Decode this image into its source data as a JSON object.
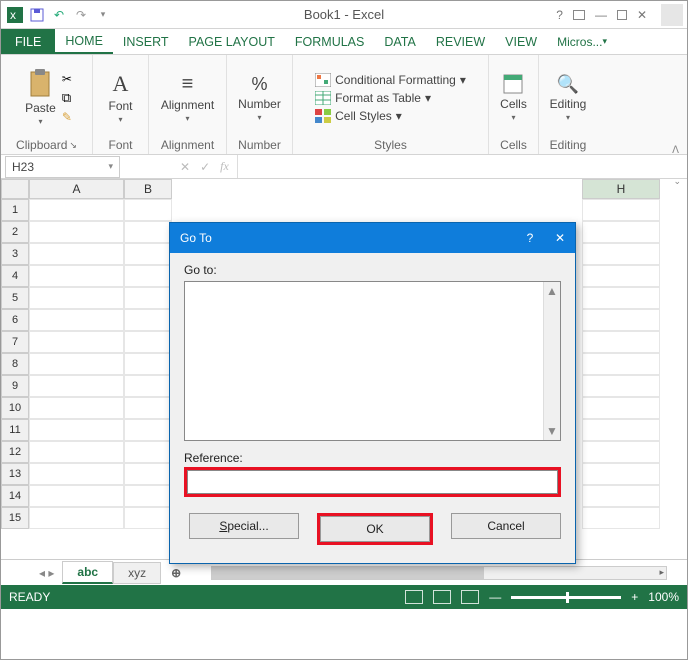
{
  "window": {
    "title": "Book1 - Excel"
  },
  "tabs": {
    "file": "FILE",
    "home": "HOME",
    "insert": "INSERT",
    "page_layout": "PAGE LAYOUT",
    "formulas": "FORMULAS",
    "data": "DATA",
    "review": "REVIEW",
    "view": "VIEW",
    "account": "Micros..."
  },
  "ribbon": {
    "clipboard": {
      "paste": "Paste",
      "label": "Clipboard"
    },
    "font": {
      "btn": "Font",
      "label": "Font"
    },
    "alignment": {
      "btn": "Alignment",
      "label": "Alignment"
    },
    "number": {
      "btn": "Number",
      "label": "Number"
    },
    "styles": {
      "cond": "Conditional Formatting",
      "table": "Format as Table",
      "cell": "Cell Styles",
      "label": "Styles"
    },
    "cells": {
      "btn": "Cells",
      "label": "Cells"
    },
    "editing": {
      "btn": "Editing",
      "label": "Editing"
    }
  },
  "namebox": "H23",
  "fx": "fx",
  "columns": [
    "A",
    "B",
    "H"
  ],
  "rows": [
    "1",
    "2",
    "3",
    "4",
    "5",
    "6",
    "7",
    "8",
    "9",
    "10",
    "11",
    "12",
    "13",
    "14",
    "15"
  ],
  "sheets": {
    "nav": "◂ ▸",
    "active": "abc",
    "other": "xyz",
    "add": "⊕"
  },
  "status": {
    "ready": "READY",
    "zoom": "100%"
  },
  "dialog": {
    "title": "Go To",
    "goto_label": "Go to:",
    "ref_label": "Reference:",
    "ref_value": "",
    "special": "Special...",
    "special_u": "S",
    "ok": "OK",
    "cancel": "Cancel",
    "help": "?",
    "close": "✕"
  }
}
